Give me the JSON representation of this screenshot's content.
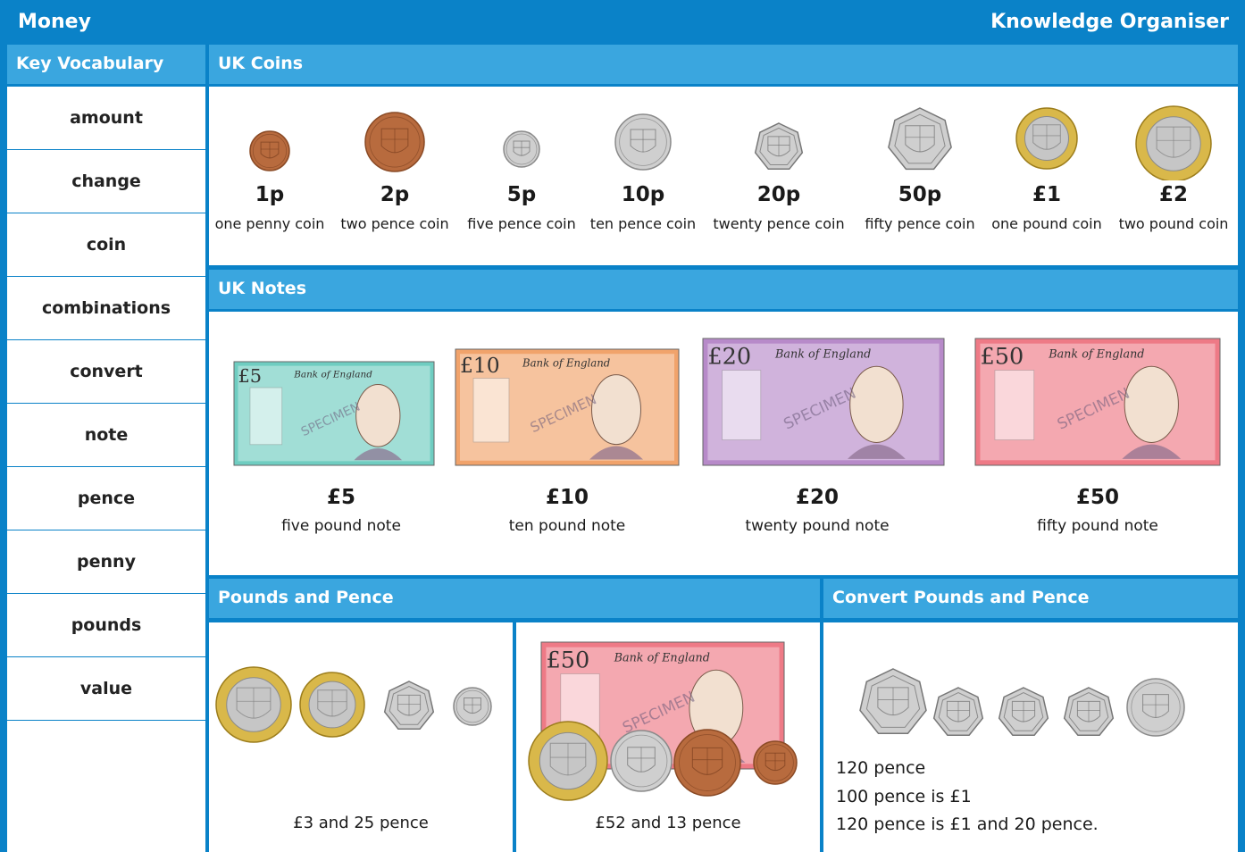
{
  "header": {
    "title": "Money",
    "subtitle": "Knowledge Organiser"
  },
  "vocab": {
    "heading": "Key Vocabulary",
    "items": [
      "amount",
      "change",
      "coin",
      "combinations",
      "convert",
      "note",
      "pence",
      "penny",
      "pounds",
      "value"
    ]
  },
  "coins": {
    "heading": "UK Coins",
    "items": [
      {
        "value": "1p",
        "name": "one penny coin",
        "color": "#b5673a"
      },
      {
        "value": "2p",
        "name": "two pence coin",
        "color": "#b5673a"
      },
      {
        "value": "5p",
        "name": "five pence coin",
        "color": "#c8c8c8"
      },
      {
        "value": "10p",
        "name": "ten pence coin",
        "color": "#c8c8c8"
      },
      {
        "value": "20p",
        "name": "twenty pence coin",
        "color": "#c8c8c8"
      },
      {
        "value": "50p",
        "name": "fifty pence coin",
        "color": "#c8c8c8"
      },
      {
        "value": "£1",
        "name": "one pound coin",
        "color": "#d4b441"
      },
      {
        "value": "£2",
        "name": "two pound coin",
        "color": "#d4b441"
      }
    ]
  },
  "notes": {
    "heading": "UK Notes",
    "items": [
      {
        "value": "£5",
        "name": "five pound note",
        "color": "#6fcdc1",
        "corner": "£5"
      },
      {
        "value": "£10",
        "name": "ten pound note",
        "color": "#f1a36b",
        "corner": "£10"
      },
      {
        "value": "£20",
        "name": "twenty pound note",
        "color": "#b78ac9",
        "corner": "£20"
      },
      {
        "value": "£50",
        "name": "fifty pound note",
        "color": "#ee7a86",
        "corner": "£50"
      }
    ],
    "specimen": "SPECIMEN",
    "bank": "Bank of England"
  },
  "pounds_pence": {
    "heading": "Pounds and Pence",
    "example1": "£3 and 25 pence",
    "example2": "£52 and 13 pence"
  },
  "convert": {
    "heading": "Convert Pounds and Pence",
    "line1": "120 pence",
    "line2": "100 pence is £1",
    "line3": "120 pence is £1 and 20 pence."
  },
  "colors": {
    "brand": "#0a82c8",
    "header_light": "#3aa6df",
    "copper": "#b5673a",
    "silver": "#c8c8c8",
    "gold": "#d4b441"
  }
}
